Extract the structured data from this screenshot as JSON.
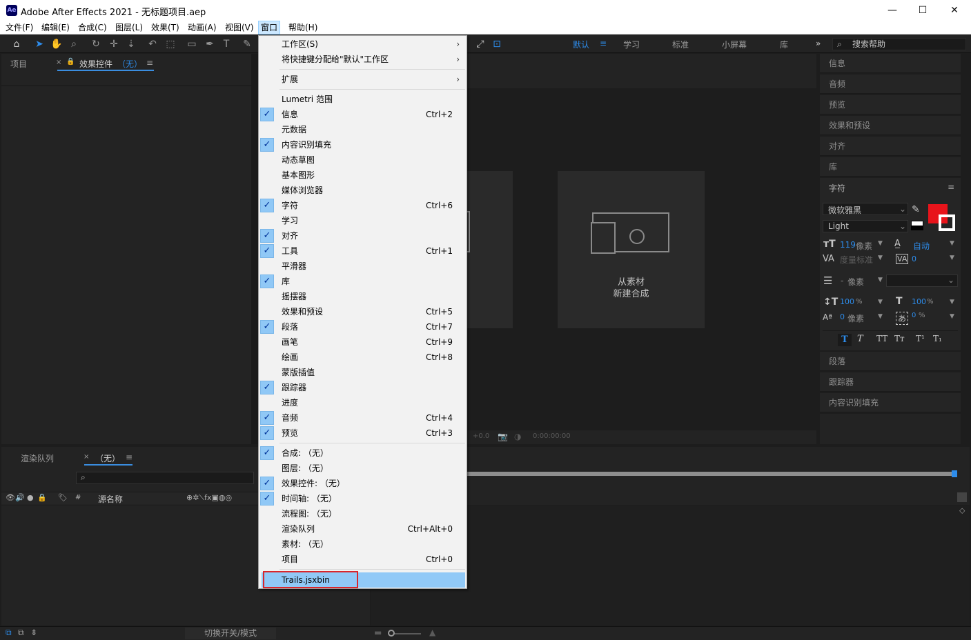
{
  "window": {
    "title": "Adobe After Effects 2021 - 无标题项目.aep",
    "logo_text": "Ae",
    "minimize": "—",
    "maximize": "☐",
    "close": "✕"
  },
  "menubar": {
    "items": [
      "文件(F)",
      "编辑(E)",
      "合成(C)",
      "图层(L)",
      "效果(T)",
      "动画(A)",
      "视图(V)",
      "窗口",
      "帮助(H)"
    ]
  },
  "workspaces": {
    "items": [
      "默认",
      "学习",
      "标准",
      "小屏幕",
      "库"
    ],
    "active_menu_icon": "≡",
    "more": "»"
  },
  "search_help": {
    "placeholder": "搜索帮助"
  },
  "left_panel": {
    "tab_project": "项目",
    "tab_effects_close": "×",
    "tab_effects": "效果控件",
    "tab_effects_suffix": "（无）",
    "tab_menu": "≡"
  },
  "comp_panel": {
    "new_from_footage_line1": "从素材",
    "new_from_footage_line2": "新建合成",
    "zoom_readout": "+0.0",
    "timecode": "0:00:00:00"
  },
  "right_panel": {
    "rows_top": [
      "信息",
      "音频",
      "预览",
      "效果和预设",
      "对齐",
      "库"
    ],
    "character_title": "字符",
    "character_menu": "≡",
    "font_family": "微软雅黑",
    "font_style": "Light",
    "font_size": "119",
    "font_size_unit": "像素",
    "leading": "自动",
    "kerning": "度量标准",
    "tracking": "0",
    "stroke_width": "-",
    "stroke_unit": "像素",
    "vscale": "100",
    "vscale_unit": "%",
    "hscale": "100",
    "hscale_unit": "%",
    "baseline": "0",
    "baseline_unit": "像素",
    "tsume": "0",
    "tsume_unit": "%",
    "text_style_buttons": [
      "T",
      "T",
      "TT",
      "Tт",
      "T¹",
      "T₁"
    ],
    "rows_bottom": [
      "段落",
      "跟踪器",
      "内容识别填充"
    ],
    "fill_color": "#e8141b",
    "stroke_color": "#ffffff"
  },
  "bottom_panel": {
    "tab_render": "渲染队列",
    "tab_timeline_close": "×",
    "tab_timeline": "（无）",
    "tab_menu": "≡",
    "col_hash": "#",
    "col_source": "源名称",
    "toggle_mode": "切换开关/模式"
  },
  "dropdown": {
    "items": [
      {
        "label": "工作区(S)",
        "arrow": "›"
      },
      {
        "label": "将快捷键分配给\"默认\"工作区",
        "arrow": "›"
      },
      {
        "label": "扩展",
        "arrow": "›"
      },
      {
        "label": "Lumetri 范围"
      },
      {
        "label": "信息",
        "shortcut": "Ctrl+2",
        "checked": true
      },
      {
        "label": "元数据"
      },
      {
        "label": "内容识别填充",
        "checked": true
      },
      {
        "label": "动态草图"
      },
      {
        "label": "基本图形"
      },
      {
        "label": "媒体浏览器"
      },
      {
        "label": "字符",
        "shortcut": "Ctrl+6",
        "checked": true
      },
      {
        "label": "学习"
      },
      {
        "label": "对齐",
        "checked": true
      },
      {
        "label": "工具",
        "shortcut": "Ctrl+1",
        "checked": true
      },
      {
        "label": "平滑器"
      },
      {
        "label": "库",
        "checked": true
      },
      {
        "label": "摇摆器"
      },
      {
        "label": "效果和预设",
        "shortcut": "Ctrl+5"
      },
      {
        "label": "段落",
        "shortcut": "Ctrl+7",
        "checked": true
      },
      {
        "label": "画笔",
        "shortcut": "Ctrl+9"
      },
      {
        "label": "绘画",
        "shortcut": "Ctrl+8"
      },
      {
        "label": "蒙版插值"
      },
      {
        "label": "跟踪器",
        "checked": true
      },
      {
        "label": "进度"
      },
      {
        "label": "音频",
        "shortcut": "Ctrl+4",
        "checked": true
      },
      {
        "label": "预览",
        "shortcut": "Ctrl+3",
        "checked": true
      },
      {
        "label": "合成: （无）",
        "checked": true
      },
      {
        "label": "图层: （无）"
      },
      {
        "label": "效果控件: （无）",
        "checked": true
      },
      {
        "label": "时间轴: （无）",
        "checked": true
      },
      {
        "label": "流程图: （无）"
      },
      {
        "label": "渲染队列",
        "shortcut": "Ctrl+Alt+0"
      },
      {
        "label": "素材: （无）"
      },
      {
        "label": "项目",
        "shortcut": "Ctrl+0"
      },
      {
        "label": "Trails.jsxbin",
        "highlighted": true
      }
    ],
    "check_glyph": "✓"
  }
}
